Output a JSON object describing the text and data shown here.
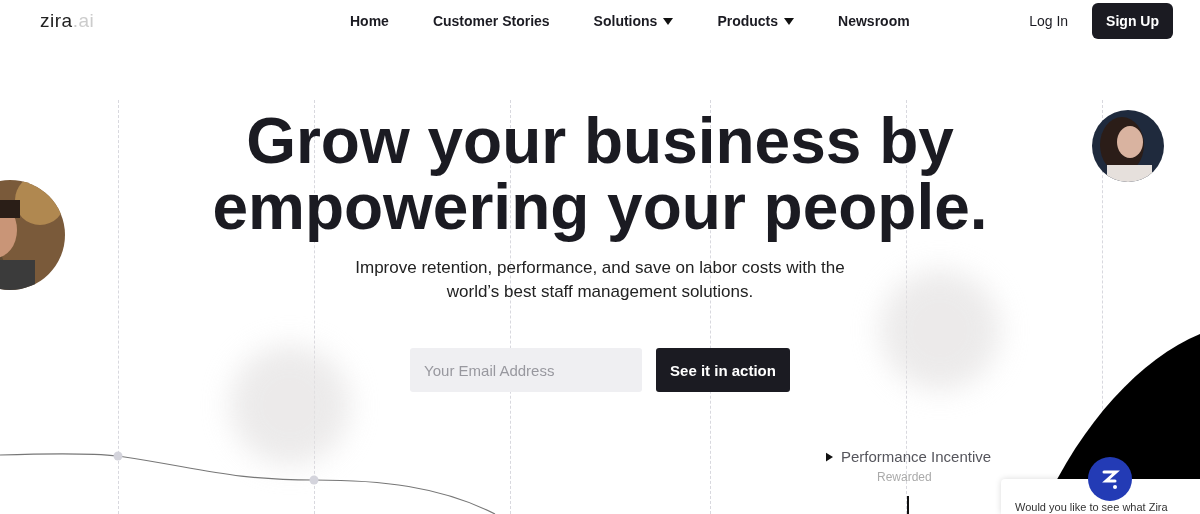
{
  "header": {
    "logo": {
      "main": "zira",
      "suffix": ".ai"
    },
    "nav": [
      {
        "label": "Home",
        "dropdown": false
      },
      {
        "label": "Customer Stories",
        "dropdown": false
      },
      {
        "label": "Solutions",
        "dropdown": true
      },
      {
        "label": "Products",
        "dropdown": true
      },
      {
        "label": "Newsroom",
        "dropdown": false
      }
    ],
    "login": "Log In",
    "signup": "Sign Up"
  },
  "hero": {
    "title": "Grow your business by empowering your people.",
    "subtitle": "Improve retention, performance, and save on labor costs with the world’s best staff management solutions.",
    "email": {
      "placeholder": "Your Email Address"
    },
    "cta": "See it in action"
  },
  "timeline": {
    "label": "Performance Incentive",
    "sublabel": "Rewarded"
  },
  "chat": {
    "message": "Would you like to see what Zira"
  }
}
